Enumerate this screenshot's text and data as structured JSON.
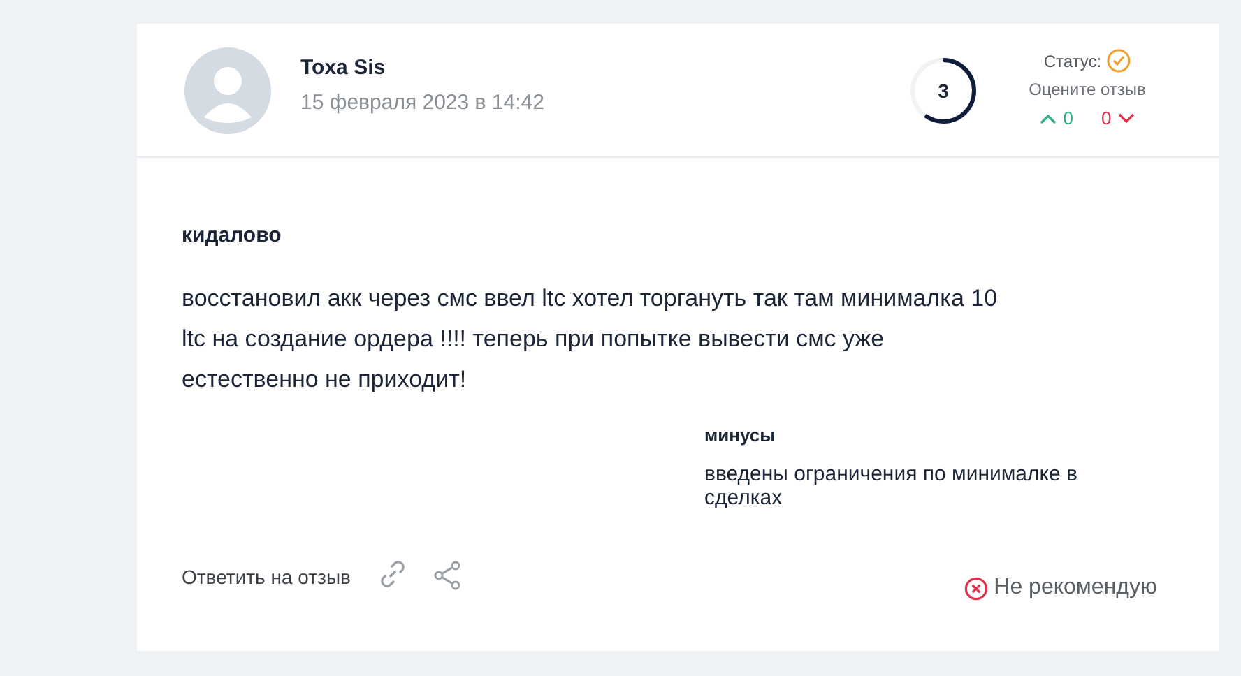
{
  "review": {
    "author": "Toxa Sis",
    "date": "15 февраля 2023 в 14:42",
    "rating": "3",
    "rating_ring": {
      "level": 0.6
    },
    "status_label": "Статус:",
    "status_verified": true,
    "rate_prompt": "Оцените отзыв",
    "upvotes": "0",
    "downvotes": "0",
    "title": "кидалово",
    "text": "восстановил акк через смс ввел ltc хотел торгануть так там минималка 10 ltc на создание ордера !!!! теперь при попытке вывести смс уже естественно не приходит!",
    "cons_heading": "минусы",
    "cons_text": "введены ограничения по минималке в сделках",
    "reply_link": "Ответить на отзыв",
    "verdict": "Не рекомендую"
  }
}
